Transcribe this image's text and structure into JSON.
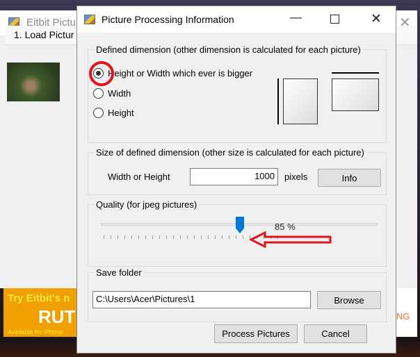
{
  "background_window": {
    "title": "Eitbit Pictu",
    "toolbar_button": "1. Load Pictur",
    "ad": {
      "line1": "Try Eitbit's n",
      "line2": "RUT",
      "line3": "Available for iPhone"
    },
    "right_ad_text": "NG"
  },
  "dialog": {
    "title": "Picture Processing Information",
    "dimension_group": {
      "legend": "Defined dimension (other dimension is calculated for each picture)",
      "options": [
        {
          "label": "Height or Width which ever is bigger",
          "selected": true
        },
        {
          "label": "Width",
          "selected": false
        },
        {
          "label": "Height",
          "selected": false
        }
      ]
    },
    "size_group": {
      "legend": "Size of defined dimension  (other size is calculated for each picture)",
      "field_label": "Width or Height",
      "value": "1000",
      "unit": "pixels",
      "info_button": "Info"
    },
    "quality_group": {
      "legend": "Quality (for jpeg pictures)",
      "value_percent": 85,
      "value_label": "85 %"
    },
    "save_group": {
      "legend": "Save folder",
      "path": "C:\\Users\\Acer\\Pictures\\1",
      "browse_button": "Browse"
    },
    "process_button": "Process Pictures",
    "cancel_button": "Cancel"
  },
  "annotation_color": "#e0121e"
}
